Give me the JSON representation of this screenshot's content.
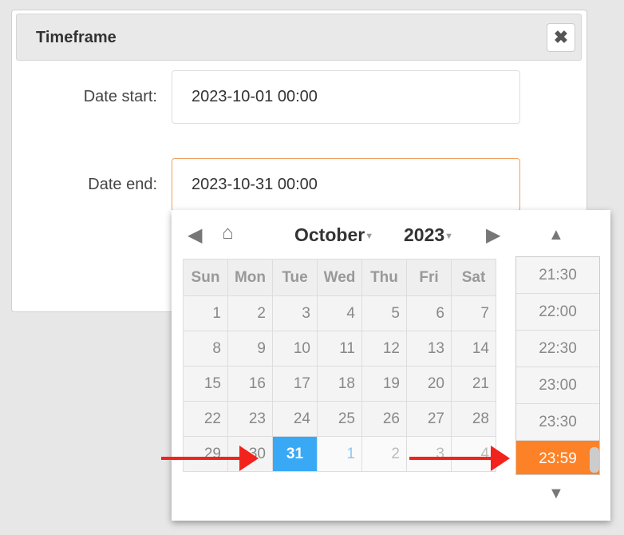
{
  "dialog": {
    "title": "Timeframe",
    "close_icon": "close-x-icon"
  },
  "form": {
    "start_label": "Date start:",
    "start_value": "2023-10-01 00:00",
    "end_label": "Date end:",
    "end_value": "2023-10-31 00:00"
  },
  "picker": {
    "month": "October",
    "year": "2023",
    "weekdays": [
      "Sun",
      "Mon",
      "Tue",
      "Wed",
      "Thu",
      "Fri",
      "Sat"
    ],
    "weeks": [
      [
        "1",
        "2",
        "3",
        "4",
        "5",
        "6",
        "7"
      ],
      [
        "8",
        "9",
        "10",
        "11",
        "12",
        "13",
        "14"
      ],
      [
        "15",
        "16",
        "17",
        "18",
        "19",
        "20",
        "21"
      ],
      [
        "22",
        "23",
        "24",
        "25",
        "26",
        "27",
        "28"
      ],
      [
        "29",
        "30",
        "31",
        "1",
        "2",
        "3",
        "4"
      ]
    ],
    "selected_day": "31",
    "times": [
      "21:30",
      "22:00",
      "22:30",
      "23:00",
      "23:30",
      "23:59"
    ],
    "selected_time": "23:59"
  },
  "colors": {
    "selected_day": "#3aa9f5",
    "selected_time": "#fd8227",
    "annotation_arrow": "#f2231d"
  }
}
